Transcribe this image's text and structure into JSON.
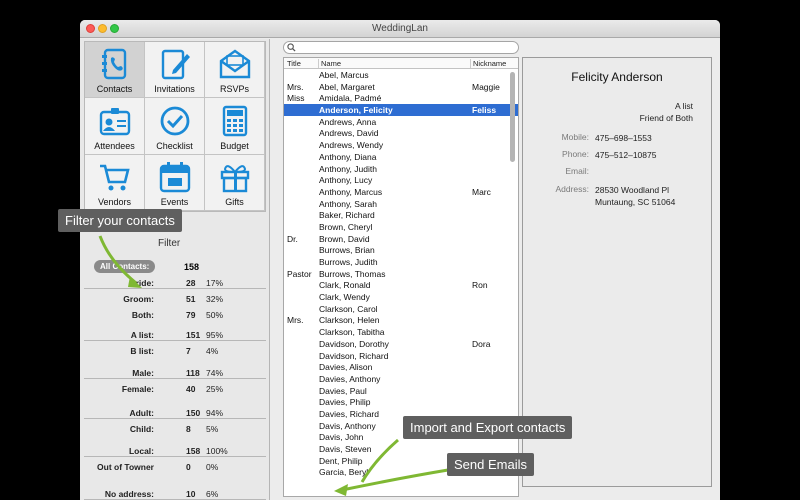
{
  "window": {
    "title": "WeddingLan"
  },
  "nav": [
    {
      "label": "Contacts",
      "icon": "contacts-icon"
    },
    {
      "label": "Invitations",
      "icon": "invitations-icon"
    },
    {
      "label": "RSVPs",
      "icon": "rsvps-icon"
    },
    {
      "label": "Attendees",
      "icon": "attendees-icon"
    },
    {
      "label": "Checklist",
      "icon": "checklist-icon"
    },
    {
      "label": "Budget",
      "icon": "budget-icon"
    },
    {
      "label": "Vendors",
      "icon": "vendors-icon"
    },
    {
      "label": "Events",
      "icon": "events-icon"
    },
    {
      "label": "Gifts",
      "icon": "gifts-icon"
    }
  ],
  "filter": {
    "title": "Filter",
    "all_label": "All Contacts:",
    "all_count": "158",
    "groups": [
      [
        {
          "label": "Bride:",
          "count": "28",
          "pct": "17%"
        },
        {
          "label": "Groom:",
          "count": "51",
          "pct": "32%"
        },
        {
          "label": "Both:",
          "count": "79",
          "pct": "50%"
        }
      ],
      [
        {
          "label": "A list:",
          "count": "151",
          "pct": "95%"
        },
        {
          "label": "B list:",
          "count": "7",
          "pct": "4%"
        }
      ],
      [
        {
          "label": "Male:",
          "count": "118",
          "pct": "74%"
        },
        {
          "label": "Female:",
          "count": "40",
          "pct": "25%"
        }
      ],
      [
        {
          "label": "Adult:",
          "count": "150",
          "pct": "94%"
        },
        {
          "label": "Child:",
          "count": "8",
          "pct": "5%"
        }
      ],
      [
        {
          "label": "Local:",
          "count": "158",
          "pct": "100%"
        },
        {
          "label": "Out of Towner",
          "count": "0",
          "pct": "0%"
        }
      ],
      [
        {
          "label": "No address:",
          "count": "10",
          "pct": "6%"
        }
      ]
    ]
  },
  "table": {
    "headers": {
      "title": "Title",
      "name": "Name",
      "nickname": "Nickname"
    },
    "rows": [
      {
        "title": "",
        "name": "Abel, Marcus",
        "nick": ""
      },
      {
        "title": "Mrs.",
        "name": "Abel, Margaret",
        "nick": "Maggie"
      },
      {
        "title": "Miss",
        "name": "Amidala, Padmé",
        "nick": ""
      },
      {
        "title": "",
        "name": "Anderson, Felicity",
        "nick": "Feliss",
        "selected": true
      },
      {
        "title": "",
        "name": "Andrews, Anna",
        "nick": ""
      },
      {
        "title": "",
        "name": "Andrews, David",
        "nick": ""
      },
      {
        "title": "",
        "name": "Andrews, Wendy",
        "nick": ""
      },
      {
        "title": "",
        "name": "Anthony, Diana",
        "nick": ""
      },
      {
        "title": "",
        "name": "Anthony, Judith",
        "nick": ""
      },
      {
        "title": "",
        "name": "Anthony, Lucy",
        "nick": ""
      },
      {
        "title": "",
        "name": "Anthony, Marcus",
        "nick": "Marc"
      },
      {
        "title": "",
        "name": "Anthony, Sarah",
        "nick": ""
      },
      {
        "title": "",
        "name": "Baker, Richard",
        "nick": ""
      },
      {
        "title": "",
        "name": "Brown, Cheryl",
        "nick": ""
      },
      {
        "title": "Dr.",
        "name": "Brown, David",
        "nick": ""
      },
      {
        "title": "",
        "name": "Burrows, Brian",
        "nick": ""
      },
      {
        "title": "",
        "name": "Burrows, Judith",
        "nick": ""
      },
      {
        "title": "Pastor",
        "name": "Burrows, Thomas",
        "nick": ""
      },
      {
        "title": "",
        "name": "Clark, Ronald",
        "nick": "Ron"
      },
      {
        "title": "",
        "name": "Clark, Wendy",
        "nick": ""
      },
      {
        "title": "",
        "name": "Clarkson, Carol",
        "nick": ""
      },
      {
        "title": "Mrs.",
        "name": "Clarkson, Helen",
        "nick": ""
      },
      {
        "title": "",
        "name": "Clarkson, Tabitha",
        "nick": ""
      },
      {
        "title": "",
        "name": "Davidson, Dorothy",
        "nick": "Dora"
      },
      {
        "title": "",
        "name": "Davidson, Richard",
        "nick": ""
      },
      {
        "title": "",
        "name": "Davies, Alison",
        "nick": ""
      },
      {
        "title": "",
        "name": "Davies, Anthony",
        "nick": ""
      },
      {
        "title": "",
        "name": "Davies, Paul",
        "nick": ""
      },
      {
        "title": "",
        "name": "Davies, Philip",
        "nick": ""
      },
      {
        "title": "",
        "name": "Davies, Richard",
        "nick": ""
      },
      {
        "title": "",
        "name": "Davis, Anthony",
        "nick": ""
      },
      {
        "title": "",
        "name": "Davis, John",
        "nick": ""
      },
      {
        "title": "",
        "name": "Davis, Steven",
        "nick": ""
      },
      {
        "title": "",
        "name": "Dent, Philip",
        "nick": ""
      },
      {
        "title": "",
        "name": "Garcia, Beryl",
        "nick": ""
      }
    ],
    "buttons": {
      "add": "+",
      "remove": "−",
      "settings": "⚙"
    }
  },
  "detail": {
    "name": "Felicity Anderson",
    "list": "A list",
    "side": "Friend of Both",
    "fields": [
      {
        "key": "Mobile:",
        "value": "475–698–1553"
      },
      {
        "key": "Phone:",
        "value": "475–512–10875"
      },
      {
        "key": "Email:",
        "value": ""
      },
      {
        "key": "Address:",
        "value": "28530 Woodland Pl\nMuntaung, SC 51064"
      }
    ]
  },
  "callouts": {
    "filter": "Filter your contacts",
    "import_export": "Import and Export contacts",
    "send_emails": "Send Emails"
  },
  "colors": {
    "selection": "#2e6dd2",
    "callout_bg": "#5f5f5f",
    "arrow": "#7fb833",
    "icon_blue": "#1b8ad6"
  }
}
